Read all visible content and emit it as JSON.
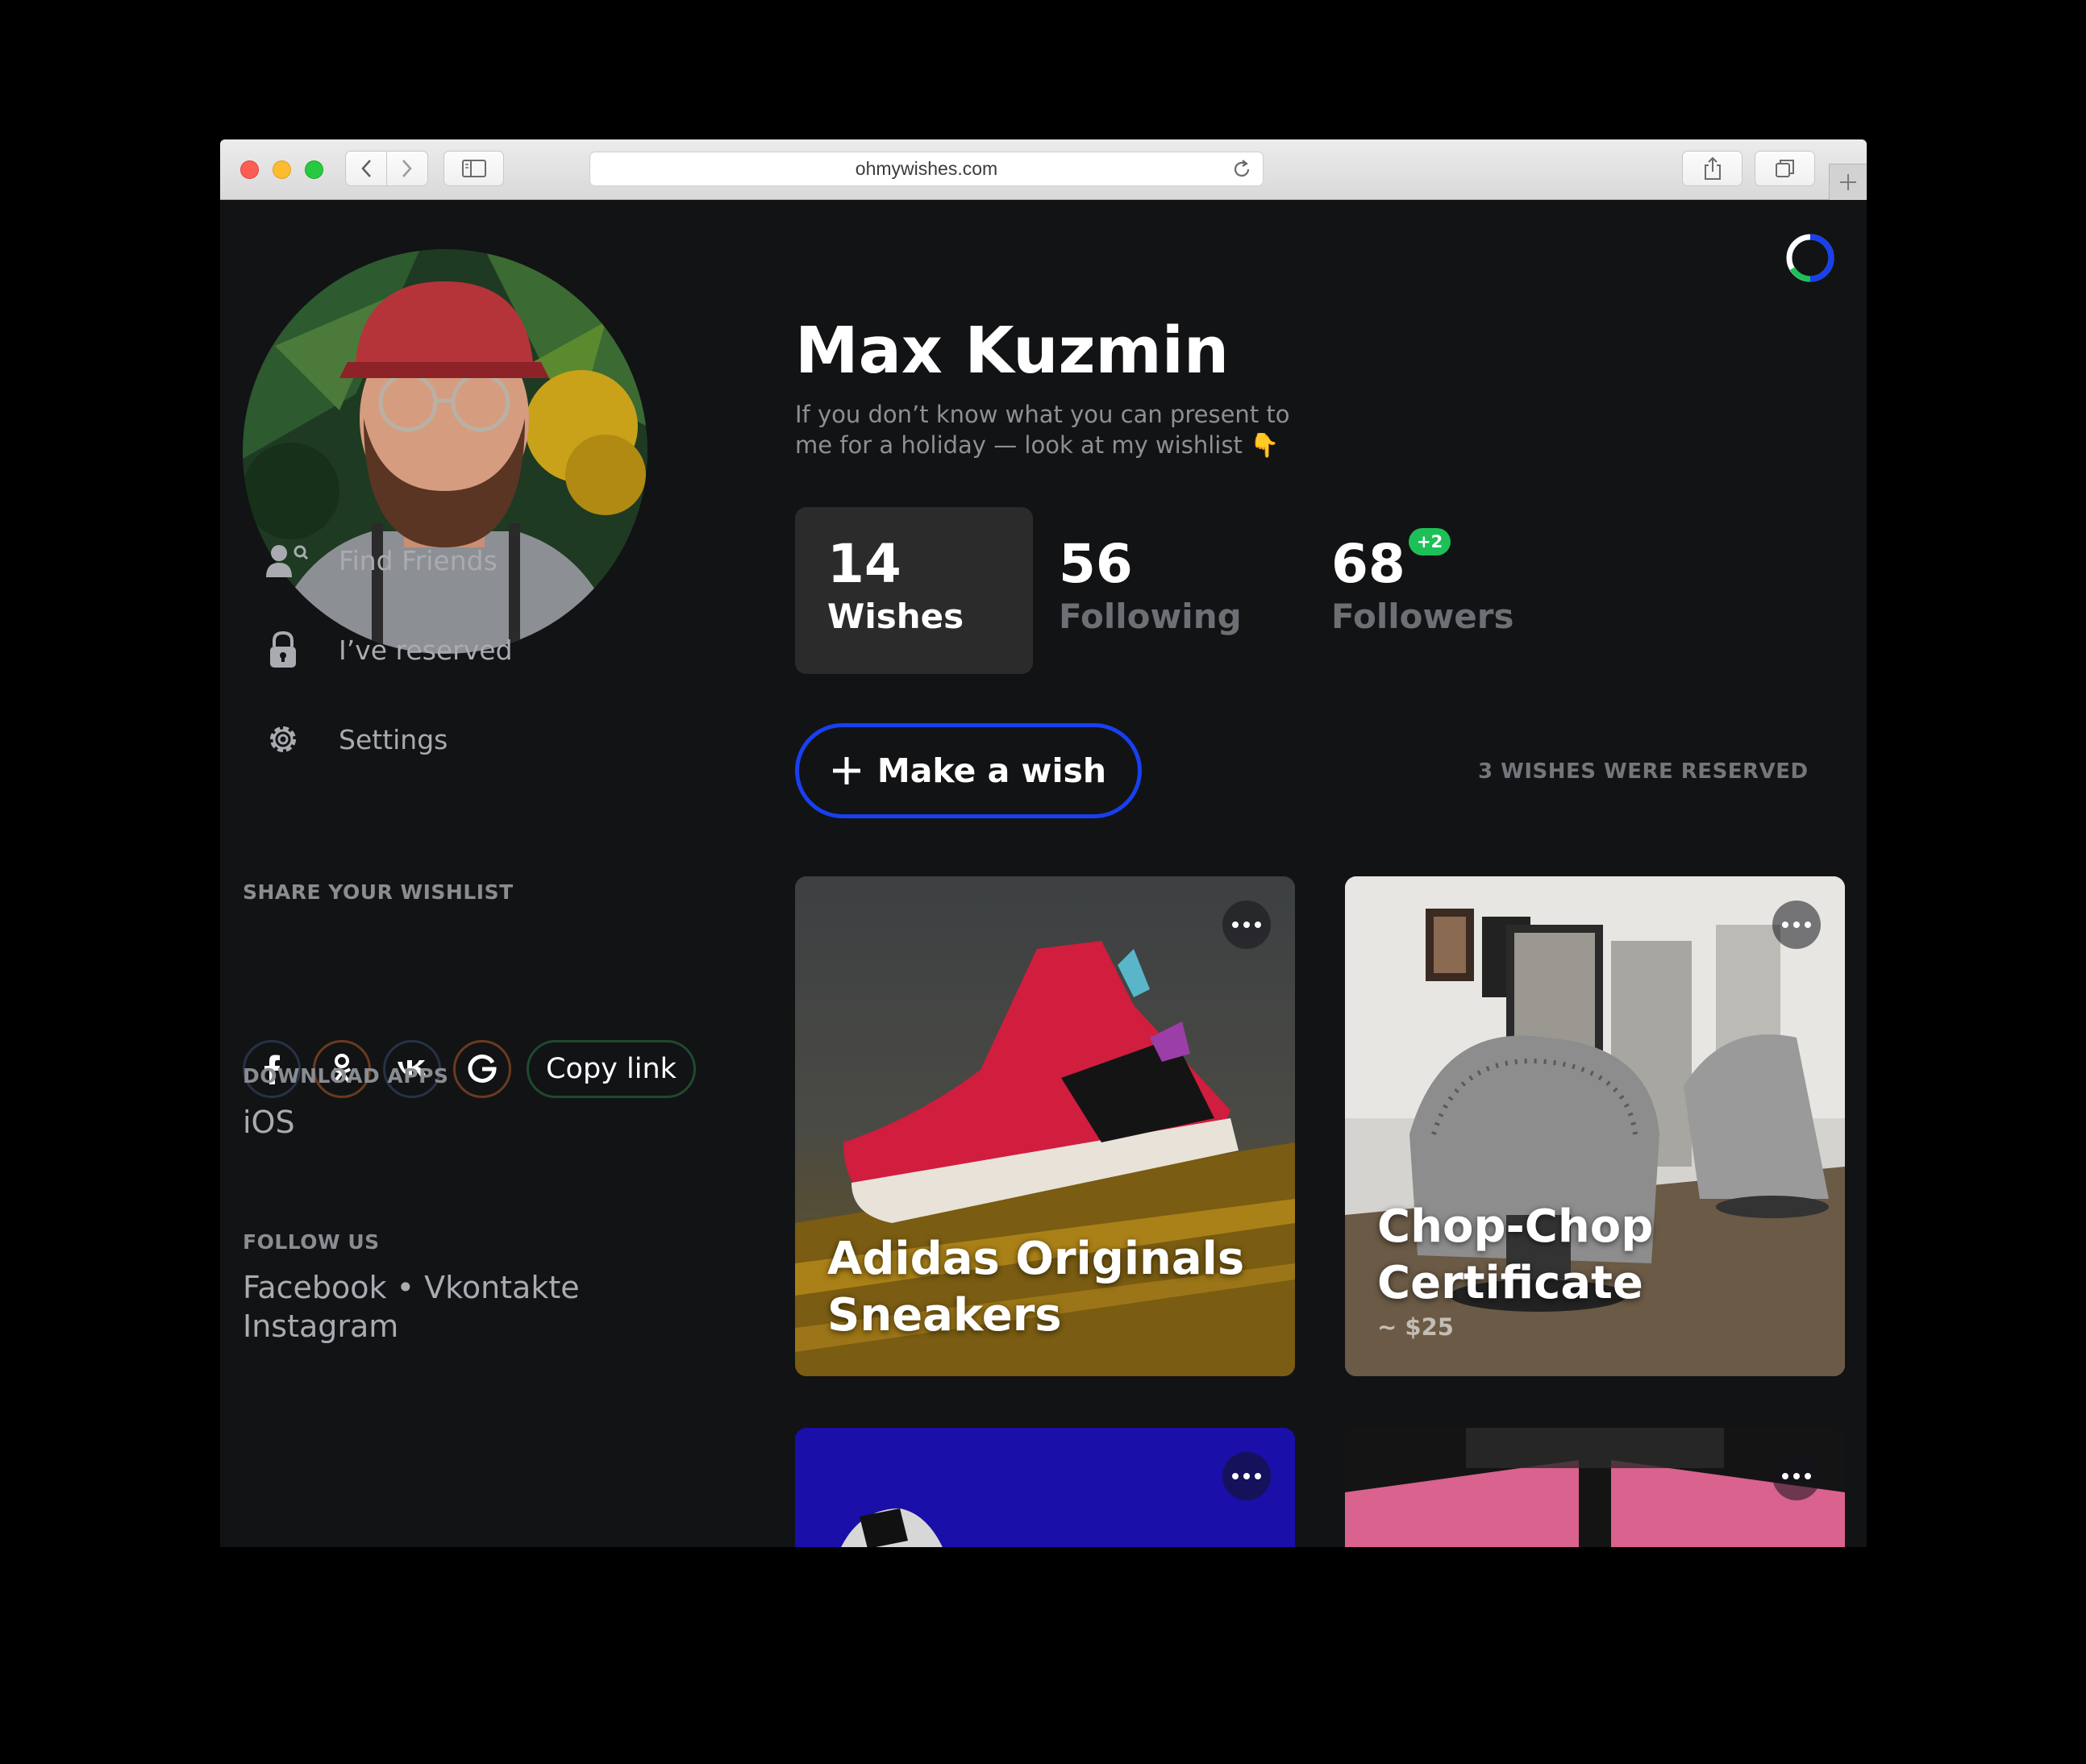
{
  "browser": {
    "url": "ohmywishes.com"
  },
  "profile": {
    "name": "Max Kuzmin",
    "bio": "If you don’t know what you can present to me for a holiday — look at my wishlist 👇"
  },
  "stats": {
    "wishes": {
      "value": "14",
      "label": "Wishes",
      "selected": true
    },
    "following": {
      "value": "56",
      "label": "Following"
    },
    "followers": {
      "value": "68",
      "label": "Followers",
      "badge": "+2"
    }
  },
  "sidebar": {
    "menu": [
      {
        "label": "Find Friends",
        "icon": "find-friends-icon"
      },
      {
        "label": "I’ve reserved",
        "icon": "lock-icon"
      },
      {
        "label": "Settings",
        "icon": "gear-icon"
      }
    ],
    "share": {
      "heading": "SHARE YOUR WISHLIST",
      "networks": [
        "facebook-icon",
        "odnoklassniki-icon",
        "vk-icon",
        "google-icon"
      ],
      "copy_label": "Copy link"
    },
    "apps": {
      "heading": "DOWNLOAD APPS",
      "ios": "iOS"
    },
    "follow": {
      "heading": "FOLLOW US",
      "facebook": "Facebook",
      "separator": "•",
      "vkontakte": "Vkontakte",
      "instagram": "Instagram"
    }
  },
  "actions": {
    "make_wish_label": "Make a wish",
    "reserved_note": "3 WISHES WERE RESERVED"
  },
  "wishes": [
    {
      "title": "Adidas Originals Sneakers",
      "price": ""
    },
    {
      "title": "Chop-Chop Certificate",
      "price": "~ $25"
    }
  ],
  "colors": {
    "background": "#121315",
    "accent_blue": "#1840f0",
    "badge_green": "#1dbf57",
    "stat_selected_bg": "#2b2b2c"
  }
}
